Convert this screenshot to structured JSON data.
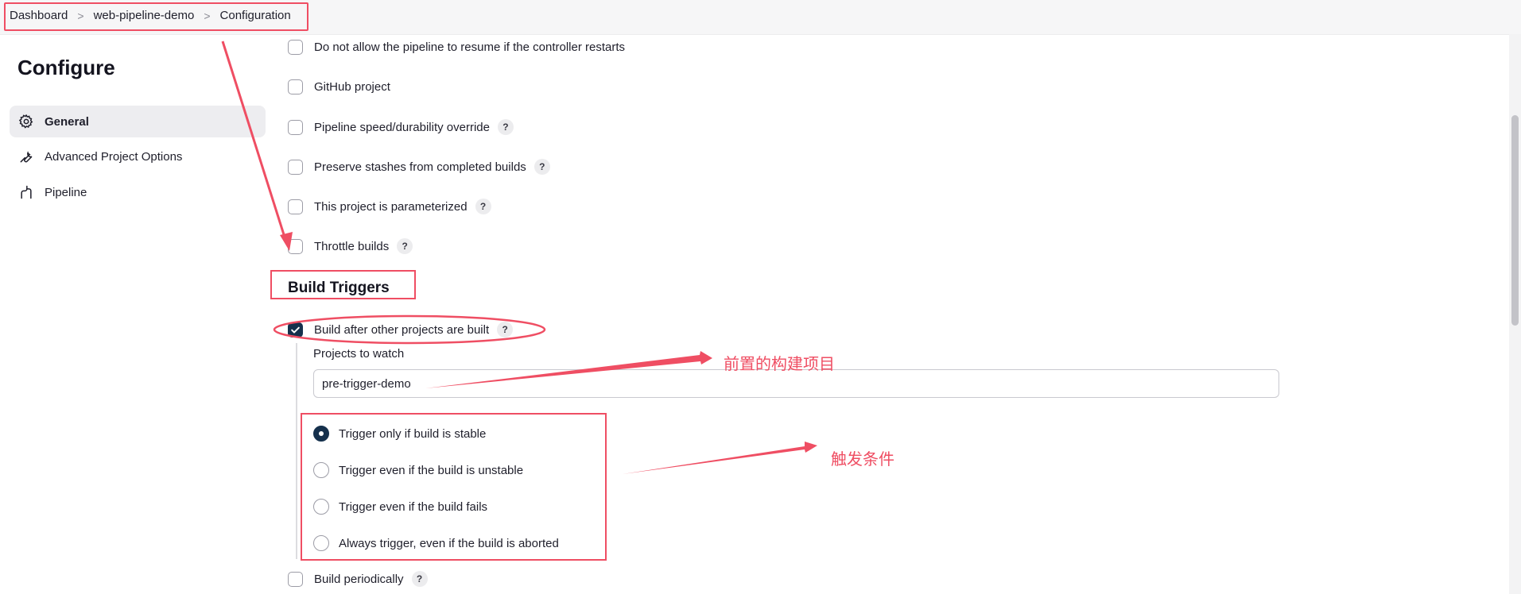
{
  "breadcrumb": {
    "items": [
      "Dashboard",
      "web-pipeline-demo",
      "Configuration"
    ],
    "separator": ">"
  },
  "sidebar": {
    "title": "Configure",
    "items": [
      {
        "label": "General",
        "icon": "gear-icon",
        "active": true
      },
      {
        "label": "Advanced Project Options",
        "icon": "wrench-icon",
        "active": false
      },
      {
        "label": "Pipeline",
        "icon": "pipeline-icon",
        "active": false
      }
    ]
  },
  "options": [
    {
      "label": "Do not allow the pipeline to resume if the controller restarts",
      "checked": false,
      "help": false
    },
    {
      "label": "GitHub project",
      "checked": false,
      "help": false
    },
    {
      "label": "Pipeline speed/durability override",
      "checked": false,
      "help": true
    },
    {
      "label": "Preserve stashes from completed builds",
      "checked": false,
      "help": true
    },
    {
      "label": "This project is parameterized",
      "checked": false,
      "help": true
    },
    {
      "label": "Throttle builds",
      "checked": false,
      "help": true
    }
  ],
  "build_triggers": {
    "title": "Build Triggers",
    "after_other": {
      "label": "Build after other projects are built",
      "checked": true
    },
    "projects_label": "Projects to watch",
    "projects_value": "pre-trigger-demo",
    "radios": [
      {
        "label": "Trigger only if build is stable",
        "selected": true
      },
      {
        "label": "Trigger even if the build is unstable",
        "selected": false
      },
      {
        "label": "Trigger even if the build fails",
        "selected": false
      },
      {
        "label": "Always trigger, even if the build is aborted",
        "selected": false
      }
    ],
    "periodically": {
      "label": "Build periodically",
      "checked": false
    }
  },
  "help_glyph": "?",
  "annotations": {
    "upstream_project": "前置的构建项目",
    "trigger_condition": "触发条件"
  },
  "colors": {
    "accent": "#15304c",
    "annotation": "#ef4e63"
  }
}
